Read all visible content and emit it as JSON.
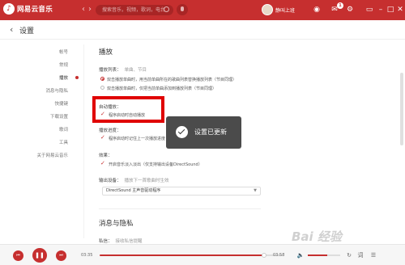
{
  "app": {
    "logo_text": "网易云音乐",
    "search_placeholder": "搜索音乐，视频，歌词，电台",
    "username": "静叫上班",
    "message_badge": "1"
  },
  "page": {
    "title": "设置"
  },
  "sidebar": {
    "items": [
      {
        "label": "帐号"
      },
      {
        "label": "常规"
      },
      {
        "label": "播放"
      },
      {
        "label": "消息与隐私"
      },
      {
        "label": "快捷键"
      },
      {
        "label": "下载设置"
      },
      {
        "label": "歌词"
      },
      {
        "label": "工具"
      },
      {
        "label": "关于网易云音乐"
      }
    ],
    "active_index": 2
  },
  "playback": {
    "section_title": "播放",
    "playlist_label": "播放列表：",
    "playlist_hint": "单曲、节目",
    "playlist_options": [
      {
        "text": "双击播放单曲时，用当前单曲所在的歌曲列表替换播放列表（节目同理）",
        "checked": true
      },
      {
        "text": "双击播放单曲时，仅把当前单曲添加到播放列表（节目同理）",
        "checked": false
      }
    ],
    "autoplay_label": "自动播放：",
    "autoplay_option": "程序启动时自动播放",
    "progress_label": "播放进度：",
    "progress_option": "程序启动时记住上一次播放进度",
    "effect_label": "效果：",
    "effect_option": "开启音乐淡入淡出（仅支持输出设备DirectSound）",
    "output_label": "输出设备：",
    "output_hint": "播放下一首歌曲时生效",
    "output_value": "DirectSound 主声音驱动程序"
  },
  "privacy": {
    "section_title": "消息与隐私",
    "dm_label": "私信：",
    "dm_hint": "接收私信提醒"
  },
  "toast": {
    "text": "设置已更新"
  },
  "player": {
    "current_time": "03:35",
    "total_time": "03:58",
    "progress_fraction": 0.9,
    "volume_fraction": 0.6
  },
  "watermark": "Bai 经验",
  "colors": {
    "brand_red": "#c62f2f",
    "highlight_border": "#e00000",
    "toast_bg": "#323232"
  },
  "icons": {
    "logo": "netease-music-logo-icon",
    "back": "chevron-left-icon",
    "forward": "chevron-right-icon",
    "search": "search-icon",
    "mic": "microphone-icon",
    "skin": "tshirt-icon",
    "mail": "mail-icon",
    "settings": "gear-icon",
    "toast": "check-circle-icon"
  }
}
